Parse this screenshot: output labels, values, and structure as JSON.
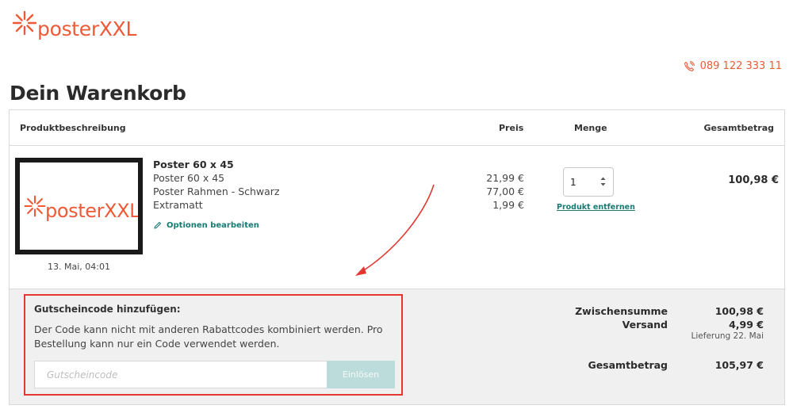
{
  "brand": {
    "name": "posterXXL",
    "color": "#ee5a37"
  },
  "header": {
    "phone": "089 122 333 11",
    "phone_icon": "phone-icon"
  },
  "page": {
    "title": "Dein Warenkorb"
  },
  "table": {
    "columns": {
      "description": "Produktbeschreibung",
      "price": "Preis",
      "quantity": "Menge",
      "total": "Gesamtbetrag"
    }
  },
  "item": {
    "thumbnail_text": "posterXXL",
    "date": "13. Mai, 04:01",
    "title": "Poster 60 x 45",
    "options": [
      "Poster 60 x 45",
      "Poster Rahmen - Schwarz",
      "Extramatt"
    ],
    "prices": [
      "21,99 €",
      "77,00 €",
      "1,99 €"
    ],
    "edit_label": "Optionen bearbeiten",
    "quantity": "1",
    "remove_label": "Produkt entfernen",
    "line_total": "100,98 €"
  },
  "coupon": {
    "title": "Gutscheincode hinzufügen:",
    "description": "Der Code kann nicht mit anderen Rabattcodes kombiniert werden. Pro Bestellung kann nur ein Code verwendet werden.",
    "placeholder": "Gutscheincode",
    "value": "",
    "button_label": "Einlösen"
  },
  "summary": {
    "subtotal_label": "Zwischensumme",
    "subtotal": "100,98 €",
    "shipping_label": "Versand",
    "shipping": "4,99 €",
    "delivery": "Lieferung 22. Mai",
    "grand_total_label": "Gesamtbetrag",
    "grand_total": "105,97 €"
  },
  "colors": {
    "accent": "#ee5a37",
    "link": "#177a73",
    "highlight": "#e3372f",
    "button_disabled": "#bcdcdb"
  }
}
